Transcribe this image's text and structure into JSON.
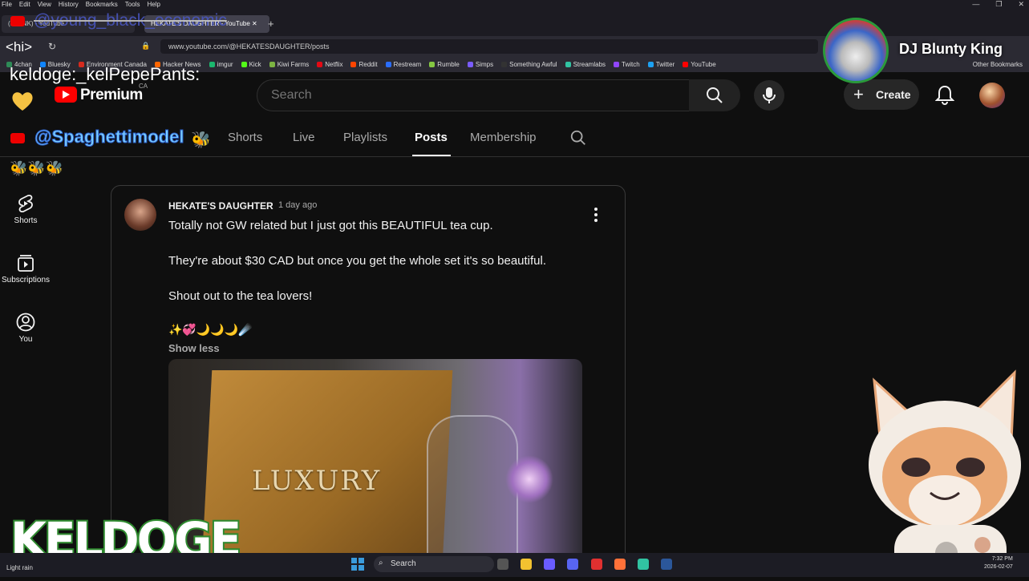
{
  "browser": {
    "menu": [
      "File",
      "Edit",
      "View",
      "History",
      "Bookmarks",
      "Tools",
      "Help"
    ],
    "tabs": [
      {
        "title": "(BLANK) - YouTube"
      },
      {
        "title": "HEKATE'S DAUGHTER - YouTube"
      }
    ],
    "url": "www.youtube.com/@HEKATESDAUGHTER/posts",
    "bookmarks": [
      {
        "label": "4chan",
        "color": "#2e8b57"
      },
      {
        "label": "Bluesky",
        "color": "#1185fe"
      },
      {
        "label": "Environment Canada",
        "color": "#d52b1e"
      },
      {
        "label": "Hacker News",
        "color": "#ff6600"
      },
      {
        "label": "imgur",
        "color": "#1bb76e"
      },
      {
        "label": "Kick",
        "color": "#53fc18"
      },
      {
        "label": "Kiwi Farms",
        "color": "#7cb342"
      },
      {
        "label": "Netflix",
        "color": "#e50914"
      },
      {
        "label": "Reddit",
        "color": "#ff4500"
      },
      {
        "label": "Restream",
        "color": "#2a6dfb"
      },
      {
        "label": "Rumble",
        "color": "#85c742"
      },
      {
        "label": "Simps",
        "color": "#7a5cff"
      },
      {
        "label": "Something Awful",
        "color": "#333333"
      },
      {
        "label": "Streamlabs",
        "color": "#31c3a2"
      },
      {
        "label": "Twitch",
        "color": "#9146ff"
      },
      {
        "label": "Twitter",
        "color": "#1da1f2"
      },
      {
        "label": "YouTube",
        "color": "#ff0000"
      }
    ],
    "other_bookmarks": "Other Bookmarks"
  },
  "youtube": {
    "logo_text": "Premium",
    "country": "CA",
    "search_placeholder": "Search",
    "create_label": "Create",
    "channel_tabs": [
      "Shorts",
      "Live",
      "Playlists",
      "Posts",
      "Membership"
    ],
    "active_tab": "Posts",
    "sidebar": [
      {
        "label": "Shorts",
        "icon": "shorts-icon"
      },
      {
        "label": "Subscriptions",
        "icon": "subscriptions-icon"
      },
      {
        "label": "You",
        "icon": "you-icon"
      }
    ],
    "post": {
      "author": "HEKATE'S DAUGHTER",
      "time": "1 day ago",
      "paragraphs": [
        "Totally not GW related but I just got this BEAUTIFUL tea cup.",
        "They're about $30 CAD but once you get the whole set it's so beautiful.",
        "Shout out to the tea lovers!"
      ],
      "emojis": "✨💞🌙🌙🌙☄️",
      "show_less": "Show less",
      "image_text": "LUXURY"
    }
  },
  "overlay": {
    "top_handle": "@young_black_economic",
    "hi_text": "<hi>",
    "chat_line": "keldoge:_kelPepePants:",
    "spaghetti_handle": "@Spaghettimodel",
    "bees": "🐝🐝🐝",
    "bee_single": "🐝",
    "dj_name": "DJ Blunty King",
    "keldoge_big": "KELDOGE"
  },
  "taskbar": {
    "weather": "Light rain",
    "search_label": "Search",
    "time": "7:32 PM",
    "date": "2026-02-07"
  },
  "colors": {
    "background": "#0f0f0f",
    "accent_red": "#ff0000",
    "text_primary": "#f1f1f1",
    "text_secondary": "#aaaaaa"
  }
}
